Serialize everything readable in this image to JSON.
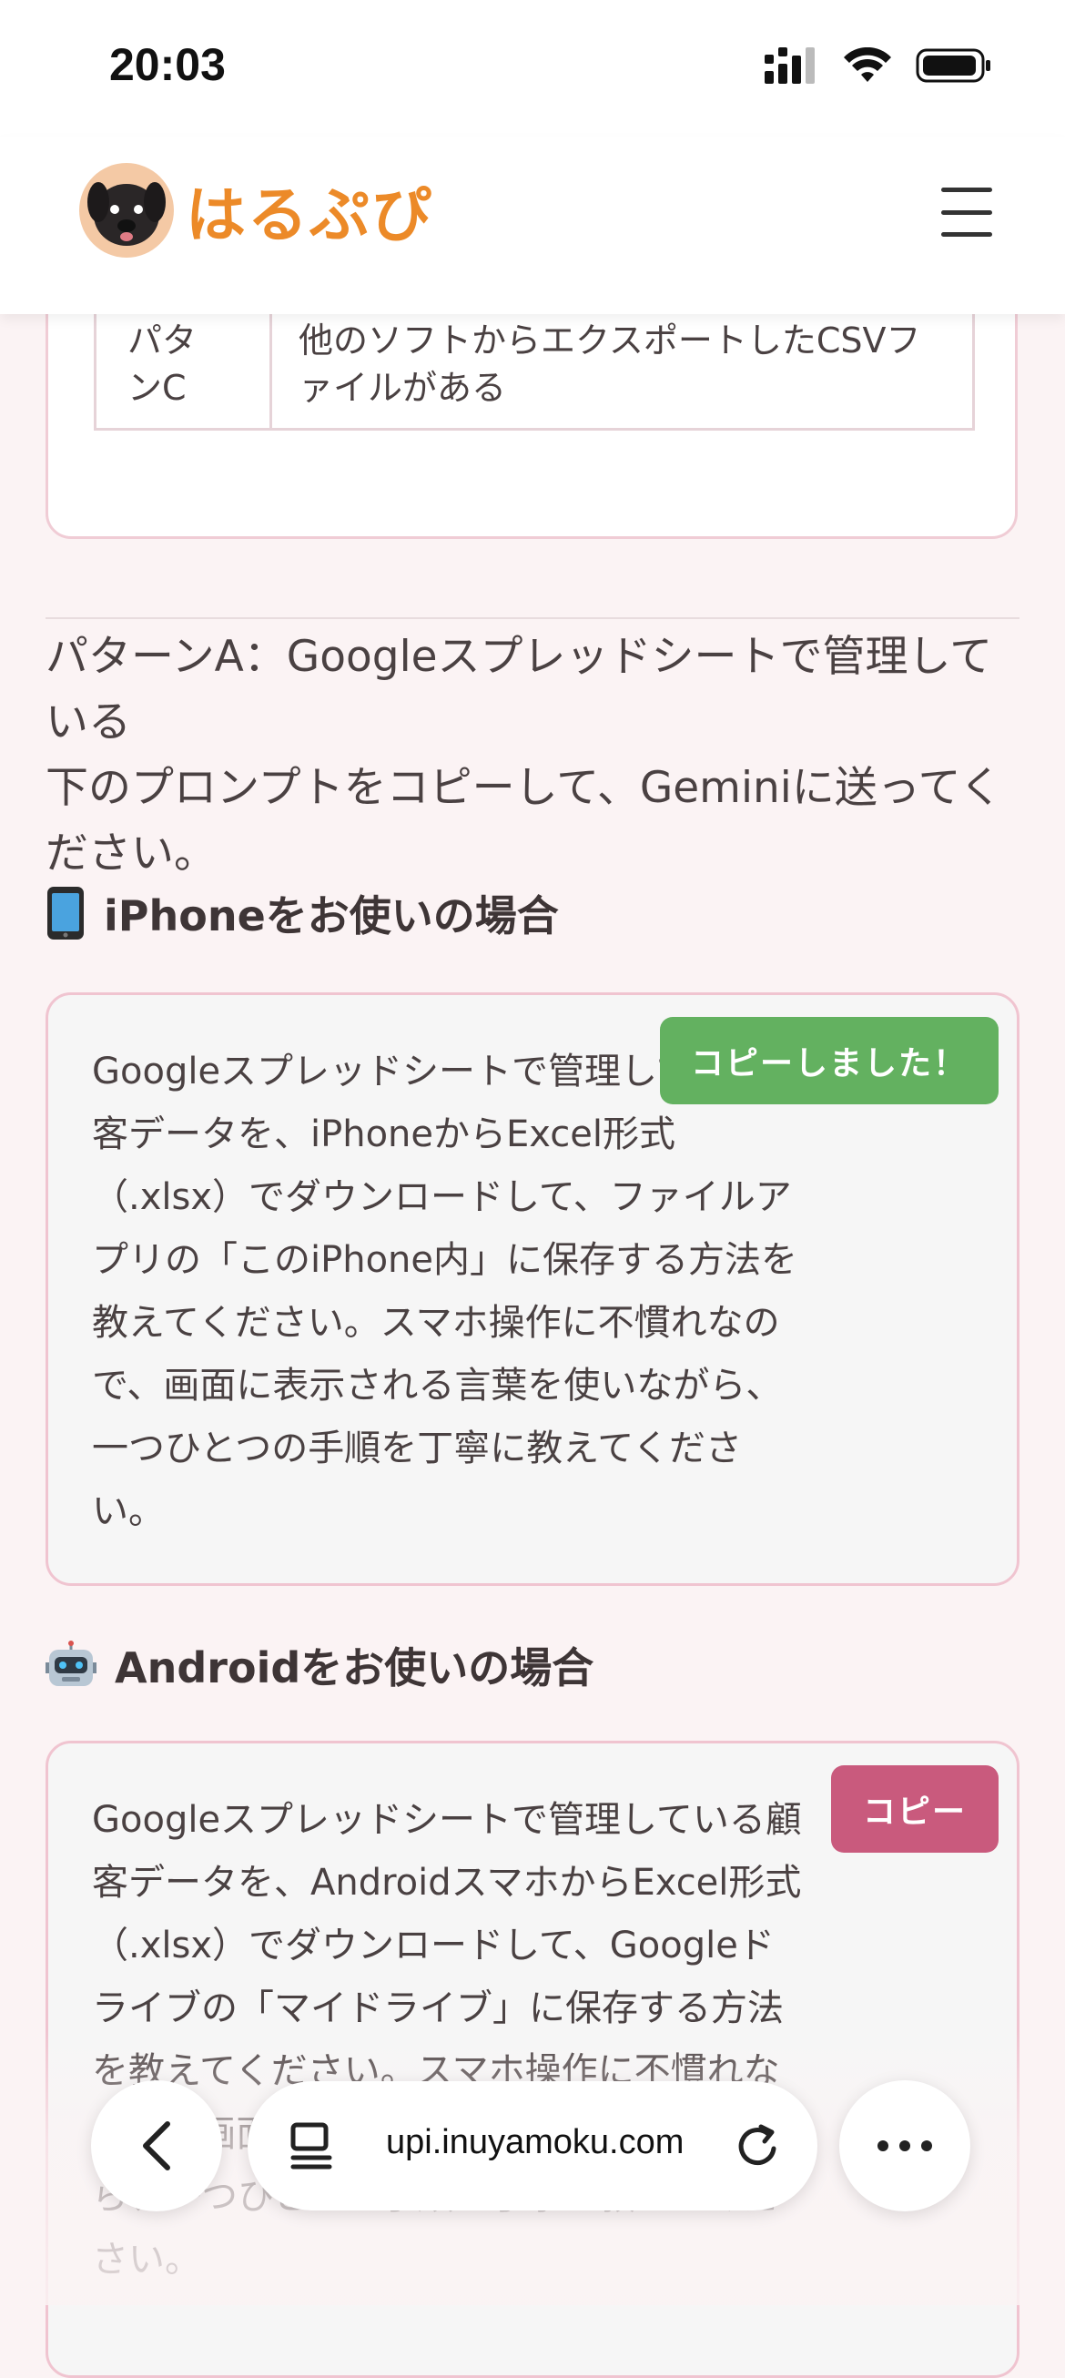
{
  "status_bar": {
    "time": "20:03"
  },
  "header": {
    "logo_text": "はるぷぴ"
  },
  "top_table": {
    "label_line1": "パタ",
    "label_line2": "ンC",
    "desc_line1": "他のソフトからエクスポートしたCSVフ",
    "desc_line2": "ァイルがある"
  },
  "intro": {
    "line1": "パターンA：Googleスプレッドシートで管理して",
    "line2": "いる",
    "line3": "下のプロンプトをコピーして、Geminiに送ってく",
    "line4": "ださい。"
  },
  "iphone_section": {
    "heading": "iPhoneをお使いの場合",
    "copy_button": "コピーしました！",
    "prompt": "Googleスプレッドシートで管理している顧客データを、iPhoneからExcel形式（.xlsx）でダウンロードして、ファイルアプリの「このiPhone内」に保存する方法を教えてください。スマホ操作に不慣れなので、画面に表示される言葉を使いながら、一つひとつの手順を丁寧に教えてください。"
  },
  "android_section": {
    "heading": "Androidをお使いの場合",
    "copy_button": "コピー",
    "prompt": "Googleスプレッドシートで管理している顧客データを、AndroidスマホからExcel形式（.xlsx）でダウンロードして、Googleドライブの「マイドライブ」に保存する方法を教えてください。スマホ操作に不慣れなので、画面に表示される言葉を使いながら、一つひとつの手順を丁寧に教えてください。"
  },
  "browser_toolbar": {
    "url": "upi.inuyamoku.com"
  },
  "icons": {
    "signal": "signal-icon",
    "wifi": "wifi-icon",
    "battery": "battery-icon",
    "menu": "hamburger-menu-icon",
    "back": "back-chevron-icon",
    "tabs": "tabs-icon",
    "reload": "reload-icon",
    "more": "more-dots-icon"
  },
  "colors": {
    "copied_green": "#63b160",
    "copy_pink": "#c95a7d",
    "logo_orange": "#ec8a28"
  }
}
